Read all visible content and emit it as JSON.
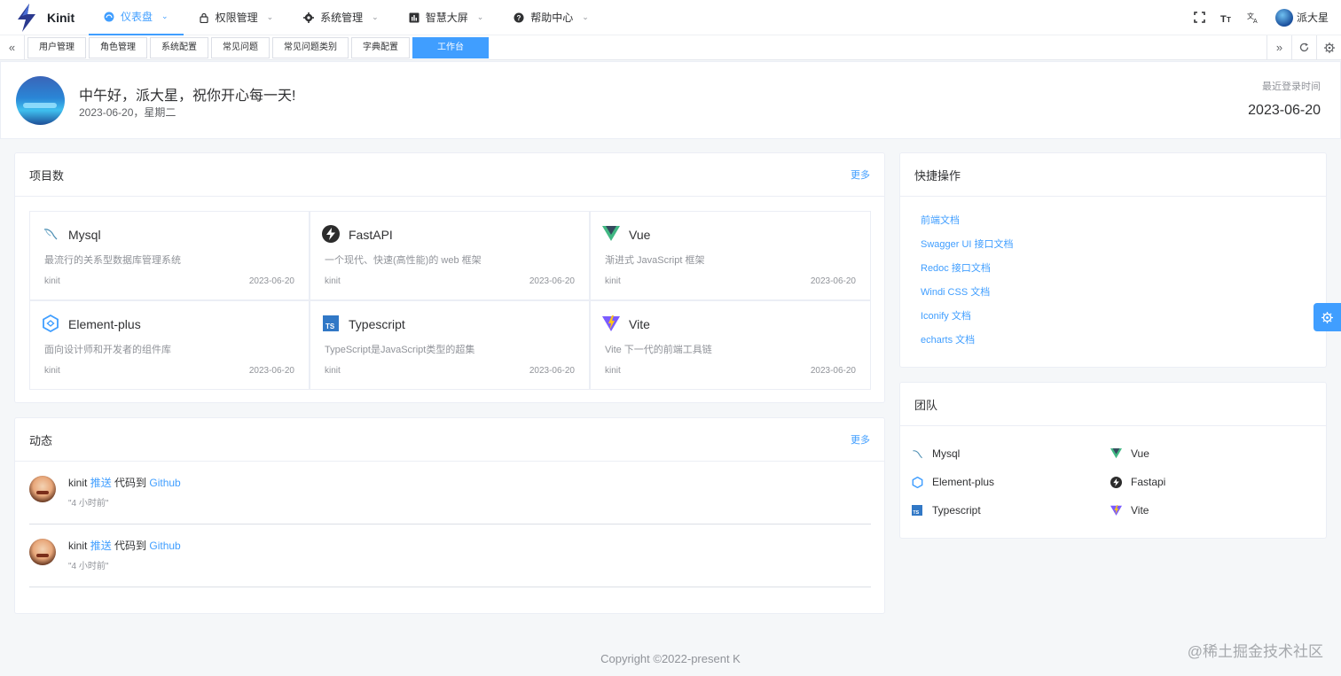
{
  "app": {
    "name": "Kinit"
  },
  "menu": [
    {
      "label": "仪表盘",
      "icon": "dashboard-icon"
    },
    {
      "label": "权限管理",
      "icon": "lock-icon"
    },
    {
      "label": "系统管理",
      "icon": "gear-icon"
    },
    {
      "label": "智慧大屏",
      "icon": "bar-chart-icon"
    },
    {
      "label": "帮助中心",
      "icon": "question-icon"
    }
  ],
  "user": {
    "name": "派大星"
  },
  "tags": [
    "用户管理",
    "角色管理",
    "系统配置",
    "常见问题",
    "常见问题类别",
    "字典配置",
    "工作台"
  ],
  "welcome": {
    "greeting": "中午好，派大星，祝你开心每一天!",
    "date": "2023-06-20，星期二",
    "last_login_label": "最近登录时间",
    "last_login_date": "2023-06-20"
  },
  "projects": {
    "title": "项目数",
    "more": "更多",
    "items": [
      {
        "name": "Mysql",
        "desc": "最流行的关系型数据库管理系统",
        "user": "kinit",
        "date": "2023-06-20",
        "icon": "mysql-icon"
      },
      {
        "name": "FastAPI",
        "desc": "一个现代、快速(高性能)的 web 框架",
        "user": "kinit",
        "date": "2023-06-20",
        "icon": "fastapi-icon"
      },
      {
        "name": "Vue",
        "desc": "渐进式 JavaScript 框架",
        "user": "kinit",
        "date": "2023-06-20",
        "icon": "vue-icon"
      },
      {
        "name": "Element-plus",
        "desc": "面向设计师和开发者的组件库",
        "user": "kinit",
        "date": "2023-06-20",
        "icon": "element-plus-icon"
      },
      {
        "name": "Typescript",
        "desc": "TypeScript是JavaScript类型的超集",
        "user": "kinit",
        "date": "2023-06-20",
        "icon": "typescript-icon"
      },
      {
        "name": "Vite",
        "desc": "Vite 下一代的前端工具链",
        "user": "kinit",
        "date": "2023-06-20",
        "icon": "vite-icon"
      }
    ]
  },
  "dynamic": {
    "title": "动态",
    "more": "更多",
    "items": [
      {
        "user": "kinit",
        "action": "推送",
        "mid": " 代码到 ",
        "target": "Github",
        "time": "\"4 小时前\""
      },
      {
        "user": "kinit",
        "action": "推送",
        "mid": " 代码到 ",
        "target": "Github",
        "time": "\"4 小时前\""
      }
    ]
  },
  "quick": {
    "title": "快捷操作",
    "links": [
      "前端文档",
      "Swagger UI 接口文档",
      "Redoc 接口文档",
      "Windi CSS 文档",
      "Iconify 文档",
      "echarts 文档"
    ]
  },
  "team": {
    "title": "团队",
    "items": [
      {
        "name": "Mysql",
        "icon": "mysql-icon"
      },
      {
        "name": "Vue",
        "icon": "vue-icon"
      },
      {
        "name": "Element-plus",
        "icon": "element-plus-icon"
      },
      {
        "name": "Fastapi",
        "icon": "fastapi-icon"
      },
      {
        "name": "Typescript",
        "icon": "typescript-icon"
      },
      {
        "name": "Vite",
        "icon": "vite-icon"
      }
    ]
  },
  "footer": {
    "copyright": "Copyright ©2022-present K"
  },
  "watermark": "@稀土掘金技术社区",
  "colors": {
    "primary": "#409eff",
    "vue_green": "#41b883",
    "vue_dark": "#35495e",
    "ts_blue": "#3178c6"
  }
}
